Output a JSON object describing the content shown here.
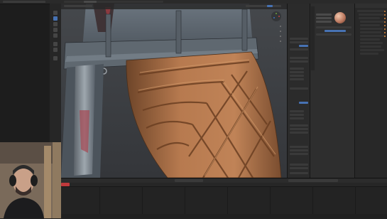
{
  "app": {
    "accent": "#4772b3",
    "playhead_color": "#c0393b"
  },
  "viewport": {
    "background": "#3b3d40",
    "subject": "3d-sculpt-belt-skirt"
  },
  "icons": [
    "move-icon",
    "rotate-icon",
    "scale-icon",
    "cursor-icon",
    "camera-icon",
    "hand-icon",
    "grid-icon",
    "material-sphere-icon"
  ],
  "colors": {
    "leather": "#b77a4f",
    "fabric": "#5d6770",
    "metal": "#8a8f95"
  }
}
